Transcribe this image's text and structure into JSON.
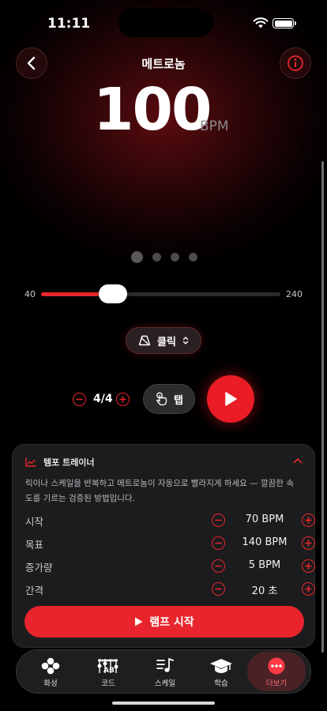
{
  "status_bar": {
    "time": "11:11"
  },
  "header": {
    "title": "메트로놈"
  },
  "tempo": {
    "value": "100",
    "unit": "BPM"
  },
  "beats": {
    "count": 4,
    "accent_index": 0
  },
  "slider": {
    "min_label": "40",
    "max_label": "240",
    "min": 40,
    "max": 240,
    "value": 100
  },
  "sound": {
    "label": "클릭"
  },
  "time_signature": {
    "value": "4/4"
  },
  "tap": {
    "label": "탭"
  },
  "trainer": {
    "title": "템포 트레이너",
    "description": "릭이나 스케일을 반복하고 메트로놈이 자동으로 빨라지게 하세요 — 깔끔한 속도를 기르는 검증된 방법입니다.",
    "params": [
      {
        "label": "시작",
        "value": "70 BPM"
      },
      {
        "label": "목표",
        "value": "140 BPM"
      },
      {
        "label": "증가량",
        "value": "5 BPM"
      },
      {
        "label": "간격",
        "value": "20 초"
      }
    ],
    "start_label": "램프 시작"
  },
  "tabbar": {
    "tabs": [
      {
        "label": "화성",
        "icon": "chord-circles-icon"
      },
      {
        "label": "코드",
        "icon": "guitar-chord-icon"
      },
      {
        "label": "스케일",
        "icon": "music-note-list-icon"
      },
      {
        "label": "학습",
        "icon": "graduation-cap-icon"
      },
      {
        "label": "더보기",
        "icon": "more-icon"
      }
    ],
    "active_index": 4
  },
  "colors": {
    "accent": "#e8262d",
    "background": "#000000",
    "card": "#1c1c1e"
  }
}
